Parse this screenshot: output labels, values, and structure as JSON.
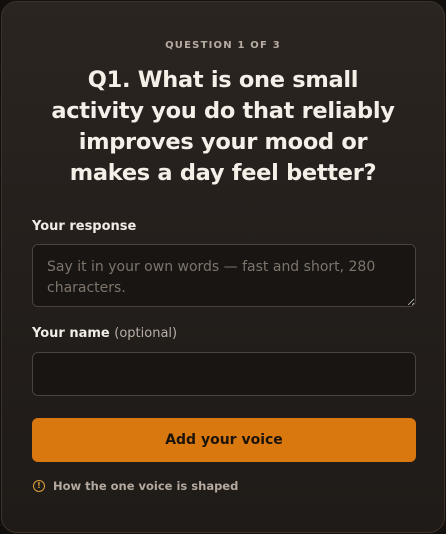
{
  "card": {
    "eyebrow": "QUESTION 1 OF 3",
    "question": "Q1. What is one small activity you do that reliably improves your mood or makes a day feel better?"
  },
  "form": {
    "response_label": "Your response",
    "response_placeholder": "Say it in your own words — fast and short, 280 characters.",
    "name_label": "Your name",
    "name_optional": "(optional)",
    "name_value": "",
    "submit_label": "Add your voice"
  },
  "footer": {
    "info_icon": "info-circle-icon",
    "info_text": "How the one voice is shaped"
  },
  "colors": {
    "accent": "#d9780f",
    "info": "#e0a03a"
  }
}
